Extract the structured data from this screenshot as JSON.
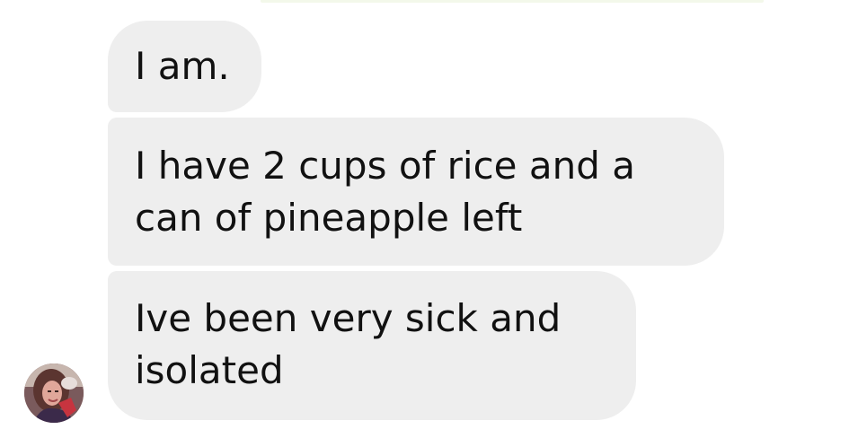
{
  "messages": [
    {
      "text": "I am."
    },
    {
      "text": "I have 2 cups of rice and a can of pineapple left"
    },
    {
      "text": "Ive been very sick and isolated"
    }
  ],
  "sender": {
    "avatar_icon": "user-photo-avatar"
  },
  "colors": {
    "bubble_bg": "#eeeeee",
    "text": "#111111",
    "page_bg": "#ffffff"
  }
}
